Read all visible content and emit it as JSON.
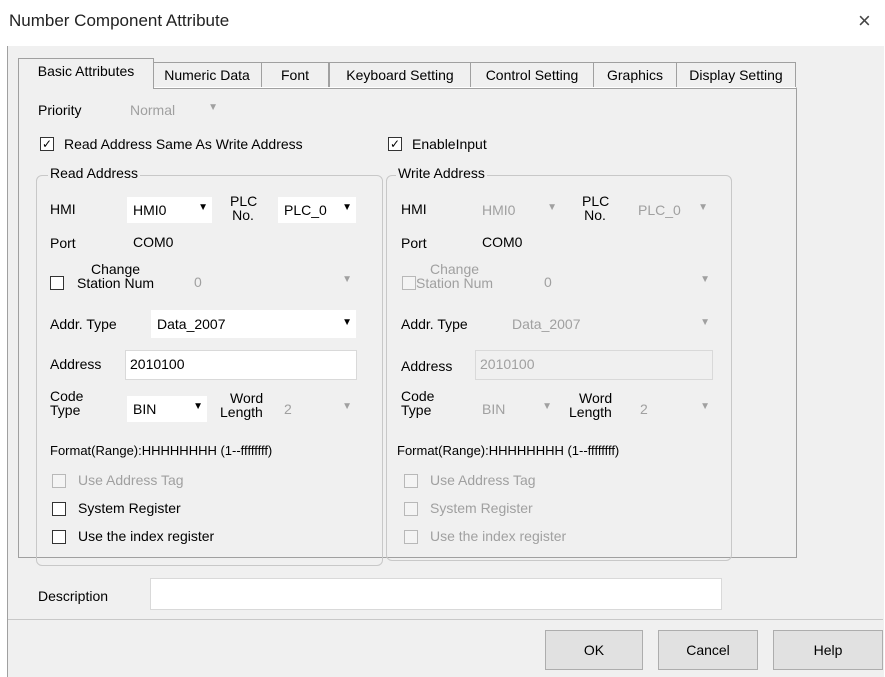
{
  "window": {
    "title": "Number Component Attribute",
    "close_glyph": "×"
  },
  "tabs": [
    {
      "label": "Basic Attributes"
    },
    {
      "label": "Numeric Data"
    },
    {
      "label": "Font"
    },
    {
      "label": "Keyboard Setting"
    },
    {
      "label": "Control Setting"
    },
    {
      "label": "Graphics"
    },
    {
      "label": "Display Setting"
    }
  ],
  "priority": {
    "label": "Priority",
    "value": "Normal"
  },
  "read_same": {
    "label": "Read Address Same As Write Address",
    "checked": "✓"
  },
  "enable_input": {
    "label": "EnableInput",
    "checked": "✓"
  },
  "read": {
    "title": "Read Address",
    "hmi_label": "HMI",
    "hmi_value": "HMI0",
    "plc_label_1": "PLC",
    "plc_label_2": "No.",
    "plc_value": "PLC_0",
    "port_label": "Port",
    "port_value": "COM0",
    "change_label_1": "Change",
    "change_label_2": "Station Num",
    "change_value": "0",
    "addr_type_label": "Addr. Type",
    "addr_type_value": "Data_2007",
    "address_label": "Address",
    "address_value": "2010100",
    "code_label_1": "Code",
    "code_label_2": "Type",
    "code_value": "BIN",
    "word_label_1": "Word",
    "word_label_2": "Length",
    "word_value": "2",
    "format": "Format(Range):HHHHHHHH (1--ffffffff)",
    "use_tag": "Use Address Tag",
    "sys_reg": "System Register",
    "index_reg": "Use the index register"
  },
  "write": {
    "title": "Write Address",
    "hmi_label": "HMI",
    "hmi_value": "HMI0",
    "plc_label_1": "PLC",
    "plc_label_2": "No.",
    "plc_value": "PLC_0",
    "port_label": "Port",
    "port_value": "COM0",
    "change_label_1": "Change",
    "change_label_2": "Station Num",
    "change_value": "0",
    "addr_type_label": "Addr. Type",
    "addr_type_value": "Data_2007",
    "address_label": "Address",
    "address_value": "2010100",
    "code_label_1": "Code",
    "code_label_2": "Type",
    "code_value": "BIN",
    "word_label_1": "Word",
    "word_label_2": "Length",
    "word_value": "2",
    "format": "Format(Range):HHHHHHHH (1--ffffffff)",
    "use_tag": "Use Address Tag",
    "sys_reg": "System Register",
    "index_reg": "Use the index register"
  },
  "description": {
    "label": "Description",
    "value": ""
  },
  "buttons": {
    "ok": "OK",
    "cancel": "Cancel",
    "help": "Help"
  },
  "colors": {
    "disabled_text": "#a0a0a0",
    "dialog_bg": "#f0f0f0"
  }
}
